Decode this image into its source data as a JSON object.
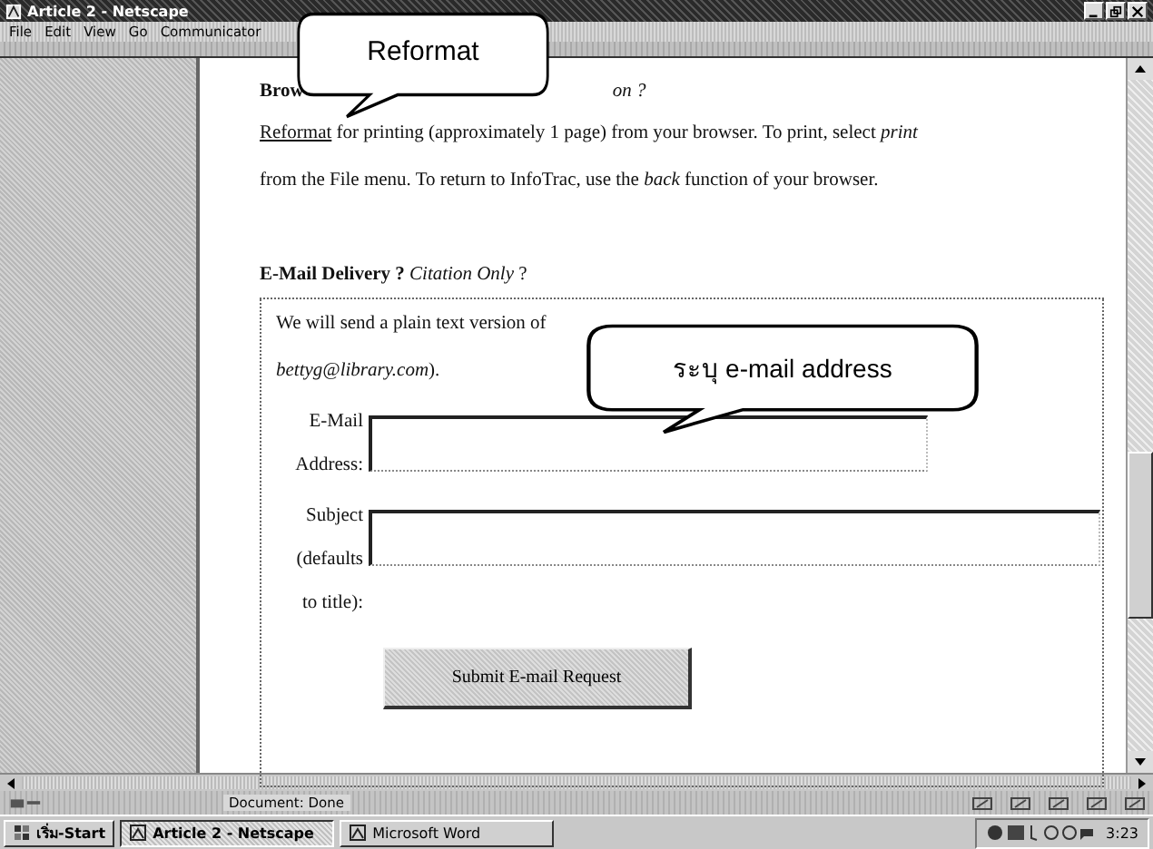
{
  "window": {
    "title": "Article 2 - Netscape"
  },
  "menu": [
    "File",
    "Edit",
    "View",
    "Go",
    "Communicator"
  ],
  "content": {
    "heading_parts": [
      "Brow",
      "on ?"
    ],
    "paragraph_link": "Reformat",
    "paragraph_lines": [
      "for printing (approximately 1 page) from your browser. To print, select *print*",
      "from the File menu. To return to InfoTrac, use the *back* function of your browser."
    ],
    "email_heading": "**E-Mail Delivery ?** *Citation Only* ?",
    "email_lines": [
      "We will send a plain text version of",
      "*bettyg@library.com*)."
    ],
    "fields": [
      {
        "label_lines": [
          "E-Mail",
          "Address:"
        ]
      },
      {
        "label_lines": [
          "Subject",
          "(defaults",
          "to title):"
        ]
      }
    ],
    "submit": "Submit E-mail Request"
  },
  "callouts": [
    {
      "text": "Reformat",
      "kind": "top"
    },
    {
      "text": "ระบุ e-mail address",
      "kind": "form"
    }
  ],
  "status_bar": "Document: Done",
  "taskbar": {
    "start": "เริ่ม-Start",
    "tasks": [
      {
        "label": "Article 2 - Netscape",
        "selected": true
      },
      {
        "label": "Microsoft Word",
        "selected": false
      }
    ],
    "clock": "3:23"
  }
}
